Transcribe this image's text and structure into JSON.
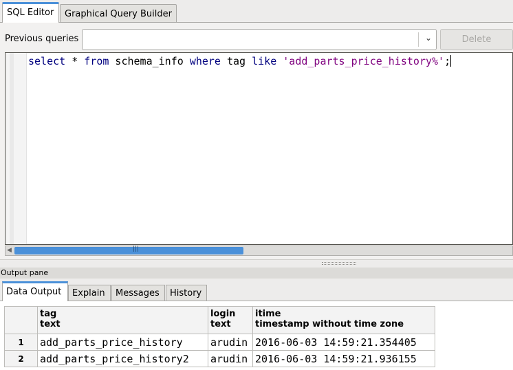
{
  "editor_tabs": [
    {
      "label": "SQL Editor",
      "active": true
    },
    {
      "label": "Graphical Query Builder",
      "active": false
    }
  ],
  "previous_queries": {
    "label": "Previous queries",
    "value": "",
    "delete_label": "Delete"
  },
  "editor": {
    "query": {
      "kw1": "select",
      "t1": " * ",
      "kw2": "from",
      "t2": " schema_info ",
      "kw3": "where",
      "t3": " tag ",
      "kw4": "like",
      "t4": " ",
      "str": "'add_parts_price_history%'",
      "end": ";"
    }
  },
  "output": {
    "pane_title": "Output pane",
    "tabs": [
      {
        "label": "Data Output",
        "active": true
      },
      {
        "label": "Explain",
        "active": false
      },
      {
        "label": "Messages",
        "active": false
      },
      {
        "label": "History",
        "active": false
      }
    ],
    "columns": [
      {
        "name": "tag",
        "type": "text"
      },
      {
        "name": "login",
        "type": "text"
      },
      {
        "name": "itime",
        "type": "timestamp without time zone"
      }
    ],
    "rows": [
      {
        "num": "1",
        "cells": [
          "add_parts_price_history",
          "arudin",
          "2016-06-03 14:59:21.354405"
        ]
      },
      {
        "num": "2",
        "cells": [
          "add_parts_price_history2",
          "arudin",
          "2016-06-03 14:59:21.936155"
        ]
      }
    ]
  },
  "colors": {
    "accent": "#4a90d9",
    "keyword": "#00007f",
    "string": "#7f007f"
  }
}
